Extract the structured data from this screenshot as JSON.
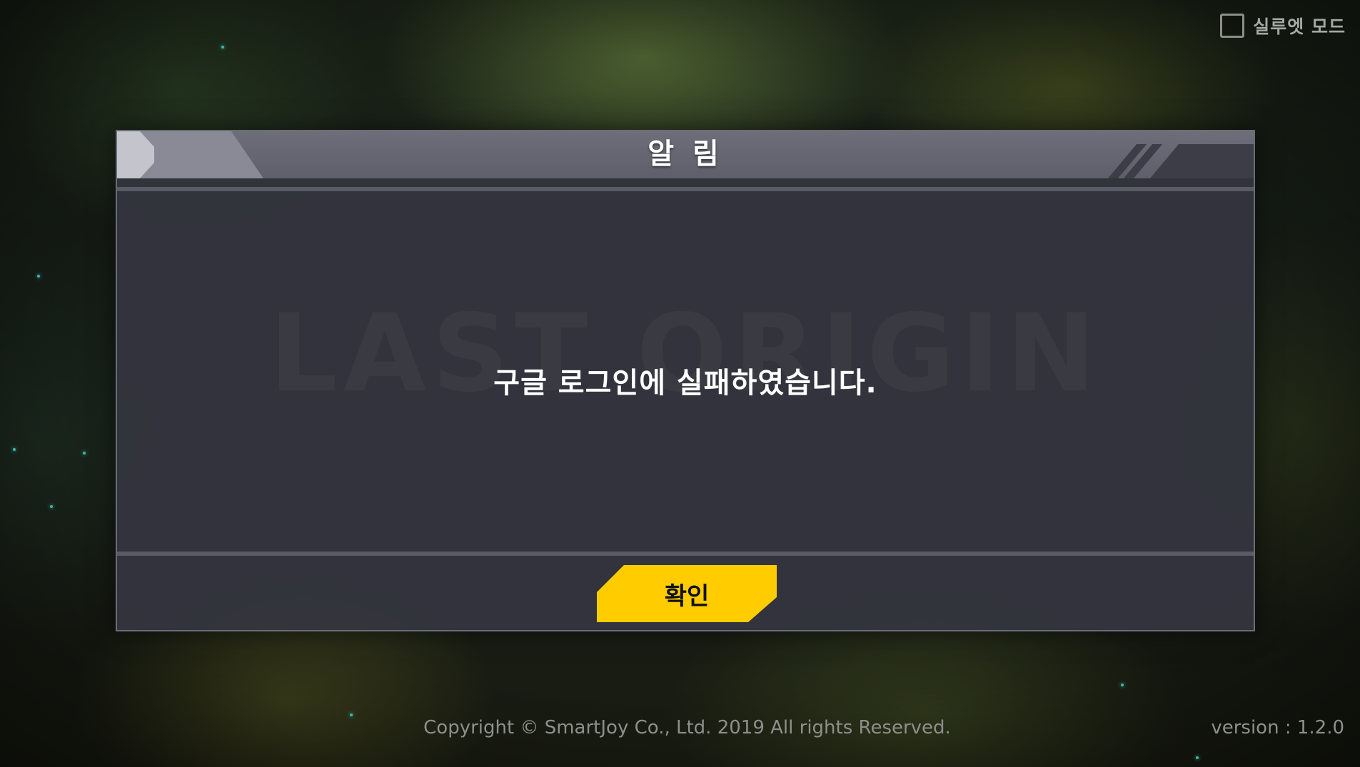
{
  "silhouette_mode": {
    "label": "실루엣 모드",
    "checked": false
  },
  "dialog": {
    "title": "알 림",
    "watermark": "LAST ORIGIN",
    "message": "구글 로그인에 실패하였습니다.",
    "confirm_label": "확인"
  },
  "footer": {
    "copyright": "Copyright © SmartJoy Co., Ltd.  2019 All rights Reserved.",
    "version": "version : 1.2.0"
  },
  "colors": {
    "accent": "#ffcc00",
    "dialog_bg": "#34353f",
    "header_bg": "#6e6e7a"
  }
}
